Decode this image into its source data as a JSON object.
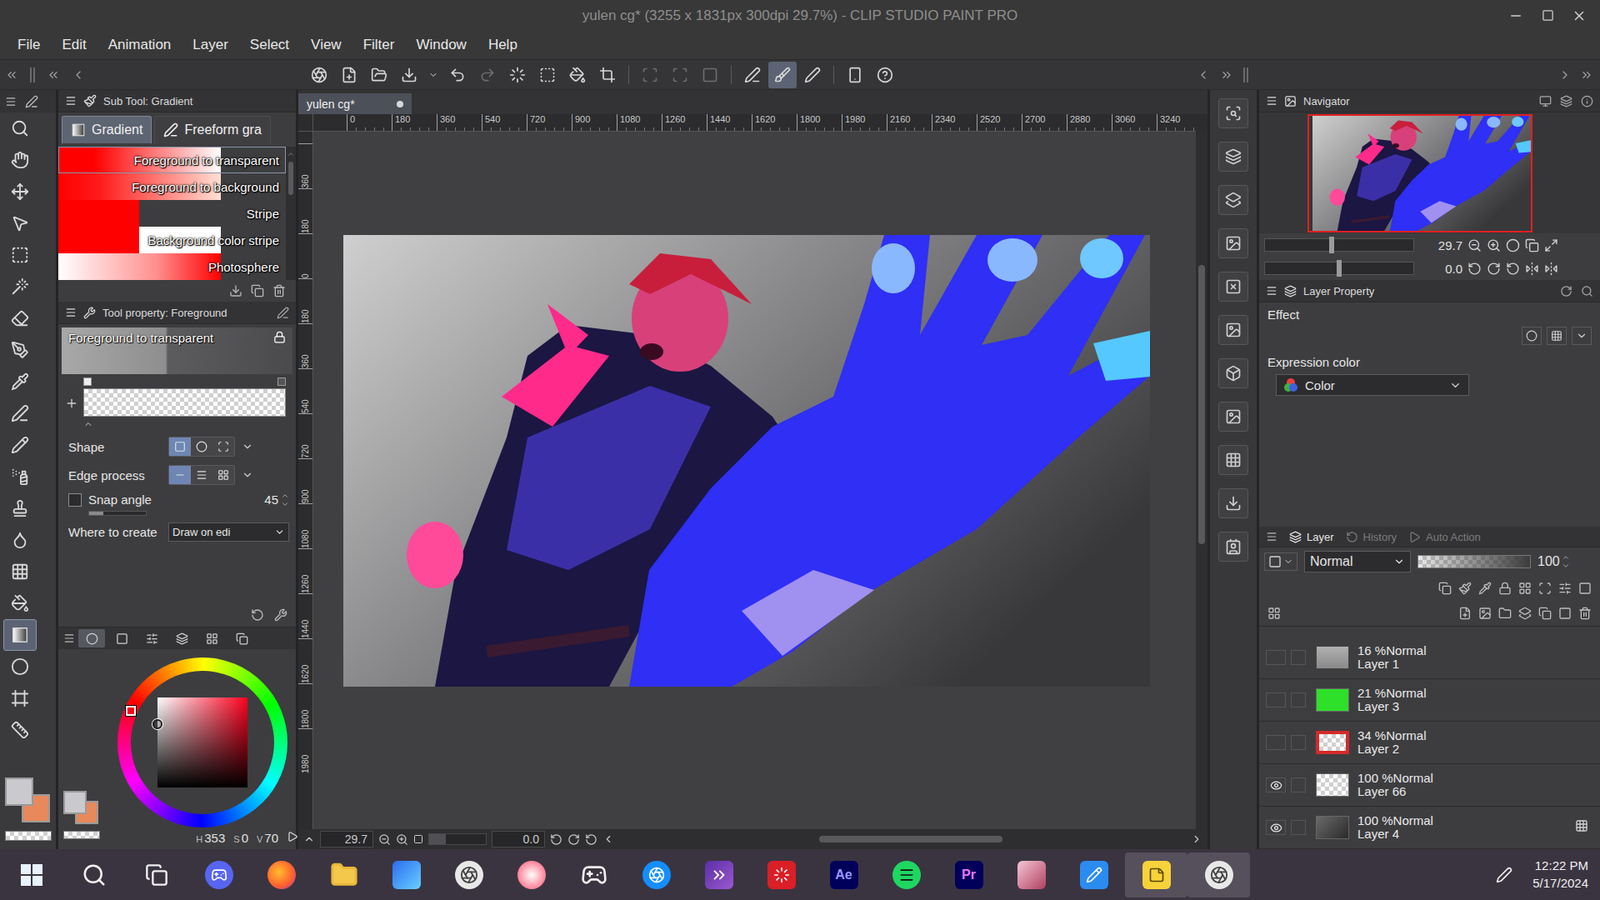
{
  "window": {
    "title": "yulen cg* (3255 x 1831px 300dpi 29.7%) - CLIP STUDIO PAINT PRO"
  },
  "menu": [
    "File",
    "Edit",
    "Animation",
    "Layer",
    "Select",
    "View",
    "Filter",
    "Window",
    "Help"
  ],
  "toolbar": [
    {
      "selected": false,
      "disabled": false
    },
    {
      "selected": false,
      "disabled": false
    },
    {
      "selected": false,
      "disabled": false
    },
    {
      "selected": false,
      "disabled": false
    },
    {
      "selected": false,
      "disabled": false
    },
    {
      "selected": false,
      "disabled": false
    },
    {
      "selected": false,
      "disabled": true
    },
    {
      "selected": false,
      "disabled": false
    },
    {
      "selected": false,
      "disabled": false
    },
    {
      "selected": false,
      "disabled": false
    },
    {
      "selected": false,
      "disabled": false
    },
    {
      "selected": false,
      "disabled": true
    },
    {
      "selected": false,
      "disabled": true
    },
    {
      "selected": false,
      "disabled": true
    },
    {
      "selected": false,
      "disabled": false
    },
    {
      "selected": true,
      "disabled": false
    },
    {
      "selected": false,
      "disabled": false
    },
    {
      "selected": false,
      "disabled": false
    },
    {
      "selected": false,
      "disabled": false
    }
  ],
  "tools": [
    {
      "selected": false
    },
    {
      "selected": false
    },
    {
      "selected": false
    },
    {
      "selected": false
    },
    {
      "selected": false
    },
    {
      "selected": false
    },
    {
      "selected": false
    },
    {
      "selected": false
    },
    {
      "selected": false
    },
    {
      "selected": false
    },
    {
      "selected": false
    },
    {
      "selected": false
    },
    {
      "selected": false
    },
    {
      "selected": false
    },
    {
      "selected": false
    },
    {
      "selected": false
    },
    {
      "selected": true
    },
    {
      "selected": false
    },
    {
      "selected": false
    },
    {
      "selected": false
    }
  ],
  "swatches": {
    "main": "#c9c9ce",
    "sub": "#e8895c"
  },
  "sub_tool": {
    "title": "Sub Tool: Gradient",
    "tabs": [
      {
        "label": "Gradient",
        "selected": true
      },
      {
        "label": "Freeform gra",
        "selected": false
      }
    ],
    "presets": [
      {
        "label": "Foreground to transparent",
        "kind": "fade",
        "selected": true
      },
      {
        "label": "Foreground to background",
        "kind": "fade-bg",
        "selected": false
      },
      {
        "label": "Stripe",
        "kind": "stripe",
        "selected": false
      },
      {
        "label": "Background color stripe",
        "kind": "bg-stripe",
        "selected": false
      },
      {
        "label": "Photosphere",
        "kind": "sphere",
        "selected": false
      }
    ]
  },
  "tool_property": {
    "title": "Tool property: Foreground",
    "preset": "Foreground to transparent",
    "rows": [
      {
        "label": "Shape",
        "kind": "toggles",
        "options": [
          {
            "selected": true
          },
          {
            "selected": false
          },
          {
            "selected": false
          }
        ]
      },
      {
        "label": "Edge process",
        "kind": "toggles",
        "options": [
          {
            "selected": true
          },
          {
            "selected": false
          },
          {
            "selected": false
          }
        ]
      },
      {
        "label": "Snap angle",
        "kind": "check",
        "checked": false,
        "value": "45",
        "level": 0.25
      },
      {
        "label": "Where to create",
        "kind": "select",
        "value": "Draw on edi"
      }
    ]
  },
  "color": {
    "tabs": [
      {
        "selected": true
      },
      {
        "selected": false
      },
      {
        "selected": false
      },
      {
        "selected": false
      },
      {
        "selected": false
      },
      {
        "selected": false
      }
    ],
    "hue": 353,
    "sat": 0,
    "val": 0.7,
    "readout": [
      {
        "label": "H",
        "value": "353"
      },
      {
        "label": "S",
        "value": "0"
      },
      {
        "label": "V",
        "value": "70"
      }
    ]
  },
  "canvas": {
    "tab": "yulen cg*",
    "ruler_h": [
      "0",
      "180",
      "360",
      "540",
      "720",
      "900",
      "1080",
      "1260",
      "1440",
      "1620",
      "1800",
      "1980",
      "2160",
      "2340",
      "2520",
      "2700",
      "2880",
      "3060",
      "3240"
    ],
    "ruler_v": [
      "360",
      "180",
      "0",
      "180",
      "360",
      "540",
      "720",
      "900",
      "1080",
      "1260",
      "1440",
      "1620",
      "1800",
      "1980"
    ],
    "zoom": "29.7",
    "angle": "0.0",
    "zoom_level": 0.3
  },
  "navigator": {
    "title": "Navigator",
    "zoom": "29.7",
    "angle": "0.0",
    "zoom_level": 0.45,
    "angle_level": 0.5
  },
  "layer_property": {
    "title": "Layer Property",
    "effect": "Effect",
    "expression_label": "Expression color",
    "expression_value": "Color"
  },
  "layers": {
    "tabs": [
      {
        "label": "Layer",
        "selected": true
      },
      {
        "label": "History",
        "selected": false
      },
      {
        "label": "Auto Action",
        "selected": false
      }
    ],
    "blend": "Normal",
    "opacity": "100",
    "opacity_level": 1,
    "items": [
      {
        "opacity": "16 %",
        "mode": "Normal",
        "name": "Layer 1",
        "visible": false,
        "thumb": "image",
        "color": "#8a8a8a",
        "marked": false
      },
      {
        "opacity": "21 %",
        "mode": "Normal",
        "name": "Layer 3",
        "visible": false,
        "thumb": "fill",
        "color": "#2fe02a",
        "marked": false
      },
      {
        "opacity": "34 %",
        "mode": "Normal",
        "name": "Layer 2",
        "visible": false,
        "thumb": "outline",
        "color": "#d42a2a",
        "marked": false
      },
      {
        "opacity": "100 %",
        "mode": "Normal",
        "name": "Layer 66",
        "visible": true,
        "thumb": "transparent",
        "color": "#ffffff",
        "marked": false
      },
      {
        "opacity": "100 %",
        "mode": "Normal",
        "name": "Layer 4",
        "visible": true,
        "thumb": "gradient",
        "color": "#2a2a2a",
        "marked": true
      }
    ]
  },
  "taskbar": {
    "apps": [
      {
        "kind": "windows",
        "selected": false
      },
      {
        "kind": "search",
        "selected": false
      },
      {
        "kind": "taskview",
        "selected": false
      },
      {
        "kind": "discord",
        "selected": false
      },
      {
        "kind": "firefox",
        "selected": false
      },
      {
        "kind": "explorer",
        "selected": false
      },
      {
        "kind": "copilot",
        "selected": false
      },
      {
        "kind": "csp",
        "selected": false
      },
      {
        "kind": "paint",
        "selected": false
      },
      {
        "kind": "game",
        "selected": false
      },
      {
        "kind": "battlenet",
        "selected": false
      },
      {
        "kind": "vs",
        "selected": false
      },
      {
        "kind": "cc",
        "selected": false
      },
      {
        "kind": "ae",
        "label": "Ae",
        "selected": false
      },
      {
        "kind": "spotify",
        "selected": false
      },
      {
        "kind": "pr",
        "label": "Pr",
        "selected": false
      },
      {
        "kind": "anime",
        "selected": false
      },
      {
        "kind": "pen",
        "selected": false
      },
      {
        "kind": "notes",
        "selected": true
      },
      {
        "kind": "csp2",
        "selected": true
      }
    ],
    "time": "12:22 PM",
    "date": "5/17/2024"
  }
}
